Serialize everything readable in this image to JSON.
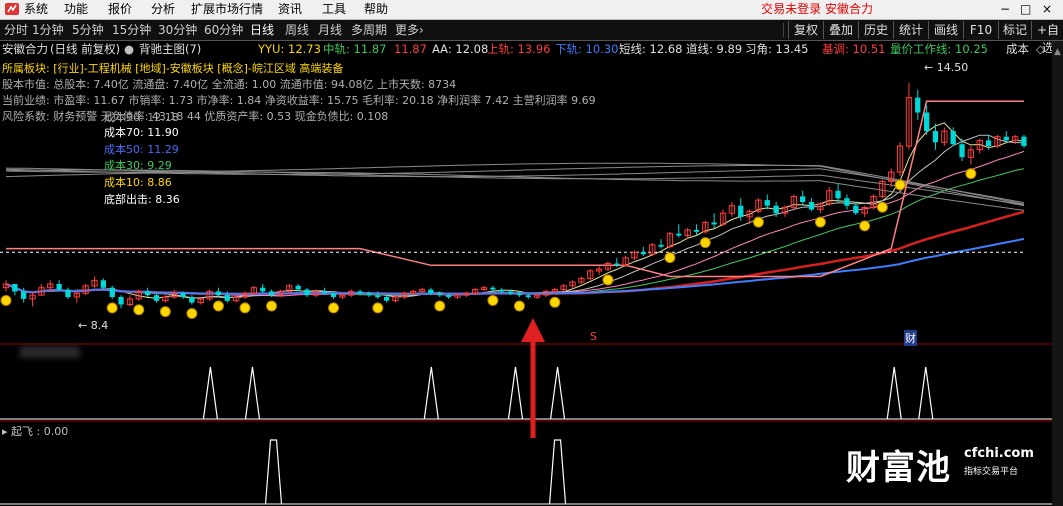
{
  "menu": {
    "items": [
      "系统",
      "功能",
      "报价",
      "分析",
      "扩展市场行情",
      "资讯",
      "工具",
      "帮助"
    ],
    "login_status": "交易未登录 安徽合力",
    "window_controls": [
      "−",
      "□",
      "×"
    ]
  },
  "periods": {
    "items": [
      "分时",
      "1分钟",
      "5分钟",
      "15分钟",
      "30分钟",
      "60分钟",
      "日线",
      "周线",
      "月线",
      "多周期",
      "更多"
    ],
    "active": "日线",
    "more_chevron": "›"
  },
  "right_buttons": [
    "复权",
    "叠加",
    "历史",
    "统计",
    "画线",
    "F10",
    "标记",
    "+自选"
  ],
  "info": {
    "stock": "安徽合力",
    "period_label": "(日线 前复权)",
    "template_label": "背驰主图(7)",
    "yyu": "YYU: 12.73",
    "mid": "中轨: 11.87",
    "mid_extra": "11.87",
    "aa": "AA: 12.08",
    "upper": "上轨: 13.96",
    "lower": "下轨: 10.30",
    "short": "短线: 12.68",
    "road": "道线: 9.89",
    "turn": "习角: 13.45",
    "base": "基调: 10.51",
    "qty_line": "量价工作线: 10.25",
    "cost": "成本"
  },
  "fundamentals": [
    "所属板块: [行业]-工程机械 [地域]-安徽板块 [概念]-皖江区域 高端装备",
    "股本市值: 总股本: 7.40亿 流通盘: 7.40亿 全流通: 1.00 流通市值: 94.08亿 上市天数: 8734",
    "当前业绩: 市盈率: 11.67 市销率: 1.73 市净率: 1.84 净资收益率: 15.75 毛利率: 20.18 净利润率 7.42 主营利润率 9.69",
    "风险系数: 财务预警 无负债率: 43.18 44 优质资产率: 0.53 现金负债比: 0.108"
  ],
  "cost_lines": [
    {
      "label": "成本90",
      "value": "12.18",
      "color": "#a0a0a0"
    },
    {
      "label": "成本70",
      "value": "11.90",
      "color": "#ffffff"
    },
    {
      "label": "成本50",
      "value": "11.29",
      "color": "#4a6cff"
    },
    {
      "label": "成本30",
      "value": "9.29",
      "color": "#3fc85a"
    },
    {
      "label": "成本10",
      "value": "8.86",
      "color": "#ffd700"
    },
    {
      "label": "底部出击",
      "value": "8.36",
      "color": "#ffffff"
    }
  ],
  "price_labels": {
    "high": "14.50",
    "low": "8.4"
  },
  "markers": {
    "s_marker": "S",
    "cai_marker": "财"
  },
  "indicator2": {
    "title": "起飞 : 0.00"
  },
  "watermark": {
    "brand": "财富池",
    "domain": "cfchi.com",
    "tagline": "指标交易平台"
  },
  "colors": {
    "up": "#ff3c3c",
    "down": "#00d7d7",
    "yellow": "#ffd700",
    "blue": "#3f7fff"
  },
  "chart_data": {
    "type": "candlestick",
    "title": "安徽合力 (日线 前复权)",
    "candles": [
      [
        9.0,
        9.2,
        8.9,
        9.1
      ],
      [
        9.1,
        9.1,
        8.8,
        8.9
      ],
      [
        8.9,
        9.0,
        8.6,
        8.7
      ],
      [
        8.7,
        8.9,
        8.5,
        8.8
      ],
      [
        8.8,
        9.1,
        8.8,
        9.0
      ],
      [
        9.0,
        9.2,
        8.9,
        9.1
      ],
      [
        9.1,
        9.2,
        8.9,
        8.95
      ],
      [
        8.95,
        9.0,
        8.7,
        8.75
      ],
      [
        8.75,
        8.9,
        8.6,
        8.85
      ],
      [
        8.85,
        9.1,
        8.8,
        9.05
      ],
      [
        9.05,
        9.3,
        9.0,
        9.2
      ],
      [
        9.2,
        9.25,
        8.95,
        9.0
      ],
      [
        9.0,
        9.05,
        8.7,
        8.75
      ],
      [
        8.75,
        8.8,
        8.45,
        8.55
      ],
      [
        8.55,
        8.8,
        8.5,
        8.7
      ],
      [
        8.7,
        8.95,
        8.65,
        8.9
      ],
      [
        8.9,
        9.0,
        8.75,
        8.8
      ],
      [
        8.8,
        8.85,
        8.6,
        8.65
      ],
      [
        8.65,
        8.8,
        8.6,
        8.75
      ],
      [
        8.75,
        8.95,
        8.7,
        8.85
      ],
      [
        8.85,
        8.9,
        8.7,
        8.75
      ],
      [
        8.75,
        8.8,
        8.55,
        8.6
      ],
      [
        8.6,
        8.75,
        8.55,
        8.7
      ],
      [
        8.7,
        8.95,
        8.65,
        8.9
      ],
      [
        8.9,
        9.0,
        8.75,
        8.8
      ],
      [
        8.8,
        8.9,
        8.6,
        8.65
      ],
      [
        8.65,
        8.8,
        8.6,
        8.75
      ],
      [
        8.75,
        8.9,
        8.7,
        8.85
      ],
      [
        8.85,
        9.05,
        8.8,
        9.0
      ],
      [
        9.0,
        9.1,
        8.85,
        8.9
      ],
      [
        8.9,
        8.95,
        8.75,
        8.8
      ],
      [
        8.8,
        8.95,
        8.75,
        8.9
      ],
      [
        8.9,
        9.1,
        8.85,
        9.05
      ],
      [
        9.05,
        9.1,
        8.9,
        8.95
      ],
      [
        8.95,
        9.0,
        8.75,
        8.8
      ],
      [
        8.8,
        8.95,
        8.75,
        8.9
      ],
      [
        8.9,
        9.0,
        8.8,
        8.85
      ],
      [
        8.85,
        8.9,
        8.7,
        8.75
      ],
      [
        8.75,
        8.85,
        8.7,
        8.8
      ],
      [
        8.8,
        8.95,
        8.75,
        8.9
      ],
      [
        8.9,
        8.95,
        8.8,
        8.85
      ],
      [
        8.85,
        8.9,
        8.75,
        8.8
      ],
      [
        8.8,
        8.9,
        8.7,
        8.75
      ],
      [
        8.75,
        8.8,
        8.6,
        8.65
      ],
      [
        8.65,
        8.8,
        8.6,
        8.75
      ],
      [
        8.75,
        8.9,
        8.7,
        8.85
      ],
      [
        8.85,
        8.95,
        8.8,
        8.9
      ],
      [
        8.9,
        9.0,
        8.85,
        8.95
      ],
      [
        8.95,
        9.0,
        8.8,
        8.85
      ],
      [
        8.85,
        8.9,
        8.75,
        8.8
      ],
      [
        8.8,
        8.85,
        8.7,
        8.75
      ],
      [
        8.75,
        8.85,
        8.7,
        8.8
      ],
      [
        8.8,
        8.9,
        8.75,
        8.85
      ],
      [
        8.85,
        9.0,
        8.8,
        8.95
      ],
      [
        8.95,
        9.05,
        8.9,
        9.0
      ],
      [
        9.0,
        9.05,
        8.9,
        8.95
      ],
      [
        8.95,
        9.0,
        8.85,
        8.9
      ],
      [
        8.9,
        8.95,
        8.8,
        8.85
      ],
      [
        8.85,
        8.9,
        8.75,
        8.8
      ],
      [
        8.8,
        8.85,
        8.7,
        8.75
      ],
      [
        8.75,
        8.85,
        8.7,
        8.8
      ],
      [
        8.8,
        8.95,
        8.75,
        8.9
      ],
      [
        8.9,
        9.0,
        8.85,
        8.95
      ],
      [
        8.95,
        9.1,
        8.9,
        9.05
      ],
      [
        9.05,
        9.2,
        9.0,
        9.15
      ],
      [
        9.15,
        9.3,
        9.1,
        9.25
      ],
      [
        9.25,
        9.5,
        9.2,
        9.45
      ],
      [
        9.45,
        9.6,
        9.35,
        9.5
      ],
      [
        9.5,
        9.7,
        9.45,
        9.65
      ],
      [
        9.65,
        9.8,
        9.55,
        9.6
      ],
      [
        9.6,
        9.85,
        9.55,
        9.8
      ],
      [
        9.8,
        10.0,
        9.75,
        9.95
      ],
      [
        9.95,
        10.1,
        9.85,
        9.9
      ],
      [
        9.9,
        10.2,
        9.85,
        10.15
      ],
      [
        10.15,
        10.3,
        10.05,
        10.1
      ],
      [
        10.1,
        10.5,
        10.05,
        10.45
      ],
      [
        10.45,
        10.7,
        10.35,
        10.4
      ],
      [
        10.4,
        10.6,
        10.3,
        10.55
      ],
      [
        10.55,
        10.7,
        10.4,
        10.5
      ],
      [
        10.5,
        10.8,
        10.45,
        10.75
      ],
      [
        10.75,
        11.0,
        10.6,
        10.7
      ],
      [
        10.7,
        11.1,
        10.65,
        11.0
      ],
      [
        11.0,
        11.3,
        10.9,
        11.2
      ],
      [
        11.2,
        11.4,
        10.8,
        10.9
      ],
      [
        10.9,
        11.1,
        10.7,
        11.05
      ],
      [
        11.05,
        11.4,
        11.0,
        11.35
      ],
      [
        11.35,
        11.5,
        11.1,
        11.2
      ],
      [
        11.2,
        11.3,
        10.9,
        11.0
      ],
      [
        11.0,
        11.2,
        10.9,
        11.15
      ],
      [
        11.15,
        11.5,
        11.1,
        11.45
      ],
      [
        11.45,
        11.6,
        11.2,
        11.3
      ],
      [
        11.3,
        11.4,
        11.05,
        11.1
      ],
      [
        11.1,
        11.3,
        11.0,
        11.25
      ],
      [
        11.25,
        11.7,
        11.2,
        11.6
      ],
      [
        11.6,
        11.8,
        11.3,
        11.4
      ],
      [
        11.4,
        11.5,
        11.1,
        11.2
      ],
      [
        11.2,
        11.3,
        10.95,
        11.0
      ],
      [
        11.0,
        11.2,
        10.9,
        11.15
      ],
      [
        11.15,
        11.5,
        11.1,
        11.45
      ],
      [
        11.45,
        11.9,
        11.4,
        11.85
      ],
      [
        11.85,
        12.2,
        11.7,
        12.1
      ],
      [
        12.1,
        12.9,
        12.0,
        12.8
      ],
      [
        12.8,
        14.5,
        12.7,
        14.1
      ],
      [
        14.1,
        14.3,
        13.5,
        13.7
      ],
      [
        13.7,
        13.9,
        13.1,
        13.2
      ],
      [
        13.2,
        13.4,
        12.7,
        12.9
      ],
      [
        12.9,
        13.3,
        12.8,
        13.2
      ],
      [
        13.2,
        13.3,
        12.8,
        12.85
      ],
      [
        12.85,
        13.0,
        12.4,
        12.5
      ],
      [
        12.5,
        12.8,
        12.3,
        12.7
      ],
      [
        12.7,
        13.0,
        12.6,
        12.95
      ],
      [
        12.95,
        13.1,
        12.7,
        12.8
      ],
      [
        12.8,
        13.1,
        12.75,
        13.05
      ],
      [
        13.05,
        13.2,
        12.9,
        12.95
      ],
      [
        12.95,
        13.1,
        12.85,
        13.05
      ],
      [
        13.05,
        13.1,
        12.75,
        12.8
      ]
    ],
    "price_range": [
      8.0,
      15.0
    ],
    "overlays": [
      "YYU",
      "中轨",
      "AA",
      "上轨",
      "下轨",
      "短线",
      "道线",
      "基调",
      "量价工作线",
      "成本"
    ],
    "signal_spikes_panel1": [
      0.2,
      0.24,
      0.41,
      0.49,
      0.53,
      0.85,
      0.88
    ],
    "signal_spikes_panel2": [
      0.26,
      0.53
    ]
  }
}
